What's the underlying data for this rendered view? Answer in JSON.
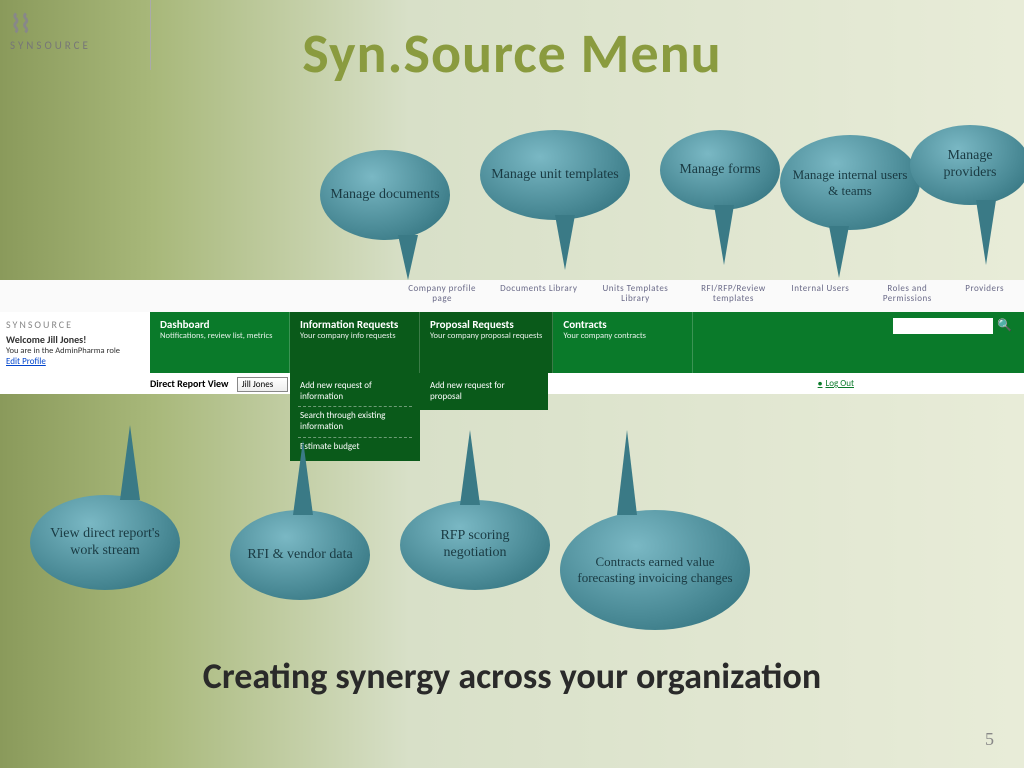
{
  "logo": {
    "brand": "SYNSOURCE"
  },
  "title": "Syn.Source Menu",
  "bubbles": {
    "docs": "Manage documents",
    "unit": "Manage unit templates",
    "forms": "Manage forms",
    "users": "Manage internal users & teams",
    "providers": "Manage providers",
    "view": "View direct report's work stream",
    "rfi": "RFI & vendor data",
    "rfp": "RFP scoring negotiation",
    "contracts": "Contracts earned value forecasting invoicing changes"
  },
  "topTabs": {
    "t1": "Company profile page",
    "t2": "Documents Library",
    "t3": "Units Templates Library",
    "t4": "RFI/RFP/Review templates",
    "t5": "Internal Users",
    "t6": "Roles and Permissions",
    "t7": "Providers"
  },
  "leftPanel": {
    "brand": "SYNSOURCE",
    "welcome": "Welcome Jill Jones!",
    "role": "You are in the AdminPharma role",
    "edit": "Edit Profile"
  },
  "greenMenu": {
    "dash": {
      "title": "Dashboard",
      "sub": "Notifications, review list, metrics"
    },
    "info": {
      "title": "Information Requests",
      "sub": "Your company info requests"
    },
    "prop": {
      "title": "Proposal Requests",
      "sub": "Your company proposal requests"
    },
    "cont": {
      "title": "Contracts",
      "sub": "Your company contracts"
    },
    "infoDrop": {
      "i1": "Add new request of information",
      "i2": "Search through existing information",
      "i3": "Estimate budget"
    },
    "propDrop": {
      "p1": "Add new request for proposal"
    }
  },
  "directReport": {
    "label": "Direct Report View",
    "selected": "Jill Jones"
  },
  "logout": "Log Out",
  "tagline": "Creating synergy across your organization",
  "pageNumber": "5"
}
